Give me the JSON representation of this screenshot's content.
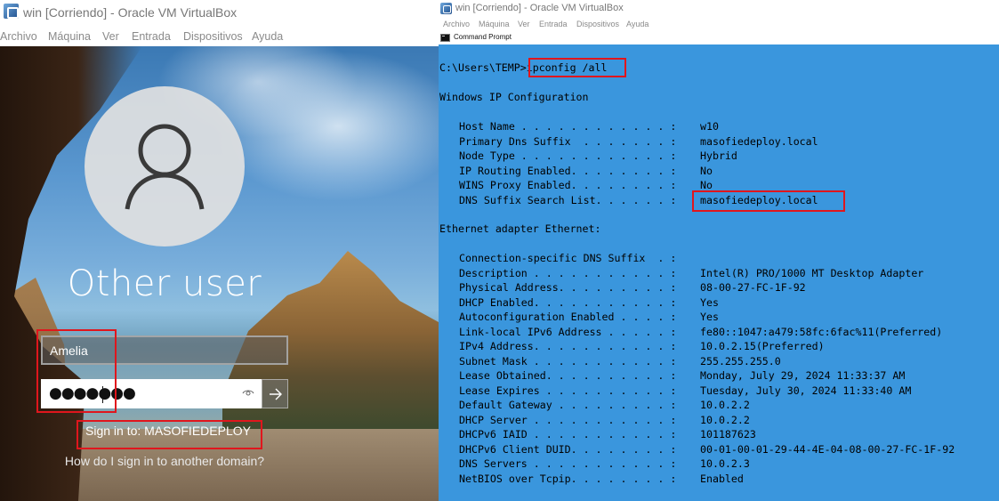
{
  "left_window": {
    "title": "win [Corriendo] - Oracle VM VirtualBox",
    "menu": [
      "Archivo",
      "Máquina",
      "Ver",
      "Entrada",
      "Dispositivos",
      "Ayuda"
    ],
    "login": {
      "user_title": "Other user",
      "username_value": "Amelia",
      "password_mask": "●●●●●●●",
      "sign_in_to": "Sign in to: MASOFIEDEPLOY",
      "other_domain_link": "How do I sign in to another domain?"
    }
  },
  "right_window": {
    "title": "win [Corriendo] - Oracle VM VirtualBox",
    "menu": [
      "Archivo",
      "Máquina",
      "Ver",
      "Entrada",
      "Dispositivos",
      "Ayuda"
    ],
    "console_title": "Command Prompt",
    "console": {
      "prompt": "C:\\Users\\TEMP>",
      "command": "ipconfig /all",
      "section1": "Windows IP Configuration",
      "rows1": [
        {
          "label": "Host Name . . . . . . . . . . . . :",
          "value": "w10"
        },
        {
          "label": "Primary Dns Suffix  . . . . . . . :",
          "value": "masofiedeploy.local"
        },
        {
          "label": "Node Type . . . . . . . . . . . . :",
          "value": "Hybrid"
        },
        {
          "label": "IP Routing Enabled. . . . . . . . :",
          "value": "No"
        },
        {
          "label": "WINS Proxy Enabled. . . . . . . . :",
          "value": "No"
        },
        {
          "label": "DNS Suffix Search List. . . . . . :",
          "value": "masofiedeploy.local"
        }
      ],
      "section2": "Ethernet adapter Ethernet:",
      "rows2": [
        {
          "label": "Connection-specific DNS Suffix  . :",
          "value": ""
        },
        {
          "label": "Description . . . . . . . . . . . :",
          "value": "Intel(R) PRO/1000 MT Desktop Adapter"
        },
        {
          "label": "Physical Address. . . . . . . . . :",
          "value": "08-00-27-FC-1F-92"
        },
        {
          "label": "DHCP Enabled. . . . . . . . . . . :",
          "value": "Yes"
        },
        {
          "label": "Autoconfiguration Enabled . . . . :",
          "value": "Yes"
        },
        {
          "label": "Link-local IPv6 Address . . . . . :",
          "value": "fe80::1047:a479:58fc:6fac%11(Preferred)"
        },
        {
          "label": "IPv4 Address. . . . . . . . . . . :",
          "value": "10.0.2.15(Preferred)"
        },
        {
          "label": "Subnet Mask . . . . . . . . . . . :",
          "value": "255.255.255.0"
        },
        {
          "label": "Lease Obtained. . . . . . . . . . :",
          "value": "Monday, July 29, 2024 11:33:37 AM"
        },
        {
          "label": "Lease Expires . . . . . . . . . . :",
          "value": "Tuesday, July 30, 2024 11:33:40 AM"
        },
        {
          "label": "Default Gateway . . . . . . . . . :",
          "value": "10.0.2.2"
        },
        {
          "label": "DHCP Server . . . . . . . . . . . :",
          "value": "10.0.2.2"
        },
        {
          "label": "DHCPv6 IAID . . . . . . . . . . . :",
          "value": "101187623"
        },
        {
          "label": "DHCPv6 Client DUID. . . . . . . . :",
          "value": "00-01-00-01-29-44-4E-04-08-00-27-FC-1F-92"
        },
        {
          "label": "DNS Servers . . . . . . . . . . . :",
          "value": "10.0.2.3"
        },
        {
          "label": "NetBIOS over Tcpip. . . . . . . . :",
          "value": "Enabled"
        }
      ]
    }
  },
  "colors": {
    "console_bg": "#3a96dd",
    "highlight_red": "#e0161d"
  }
}
